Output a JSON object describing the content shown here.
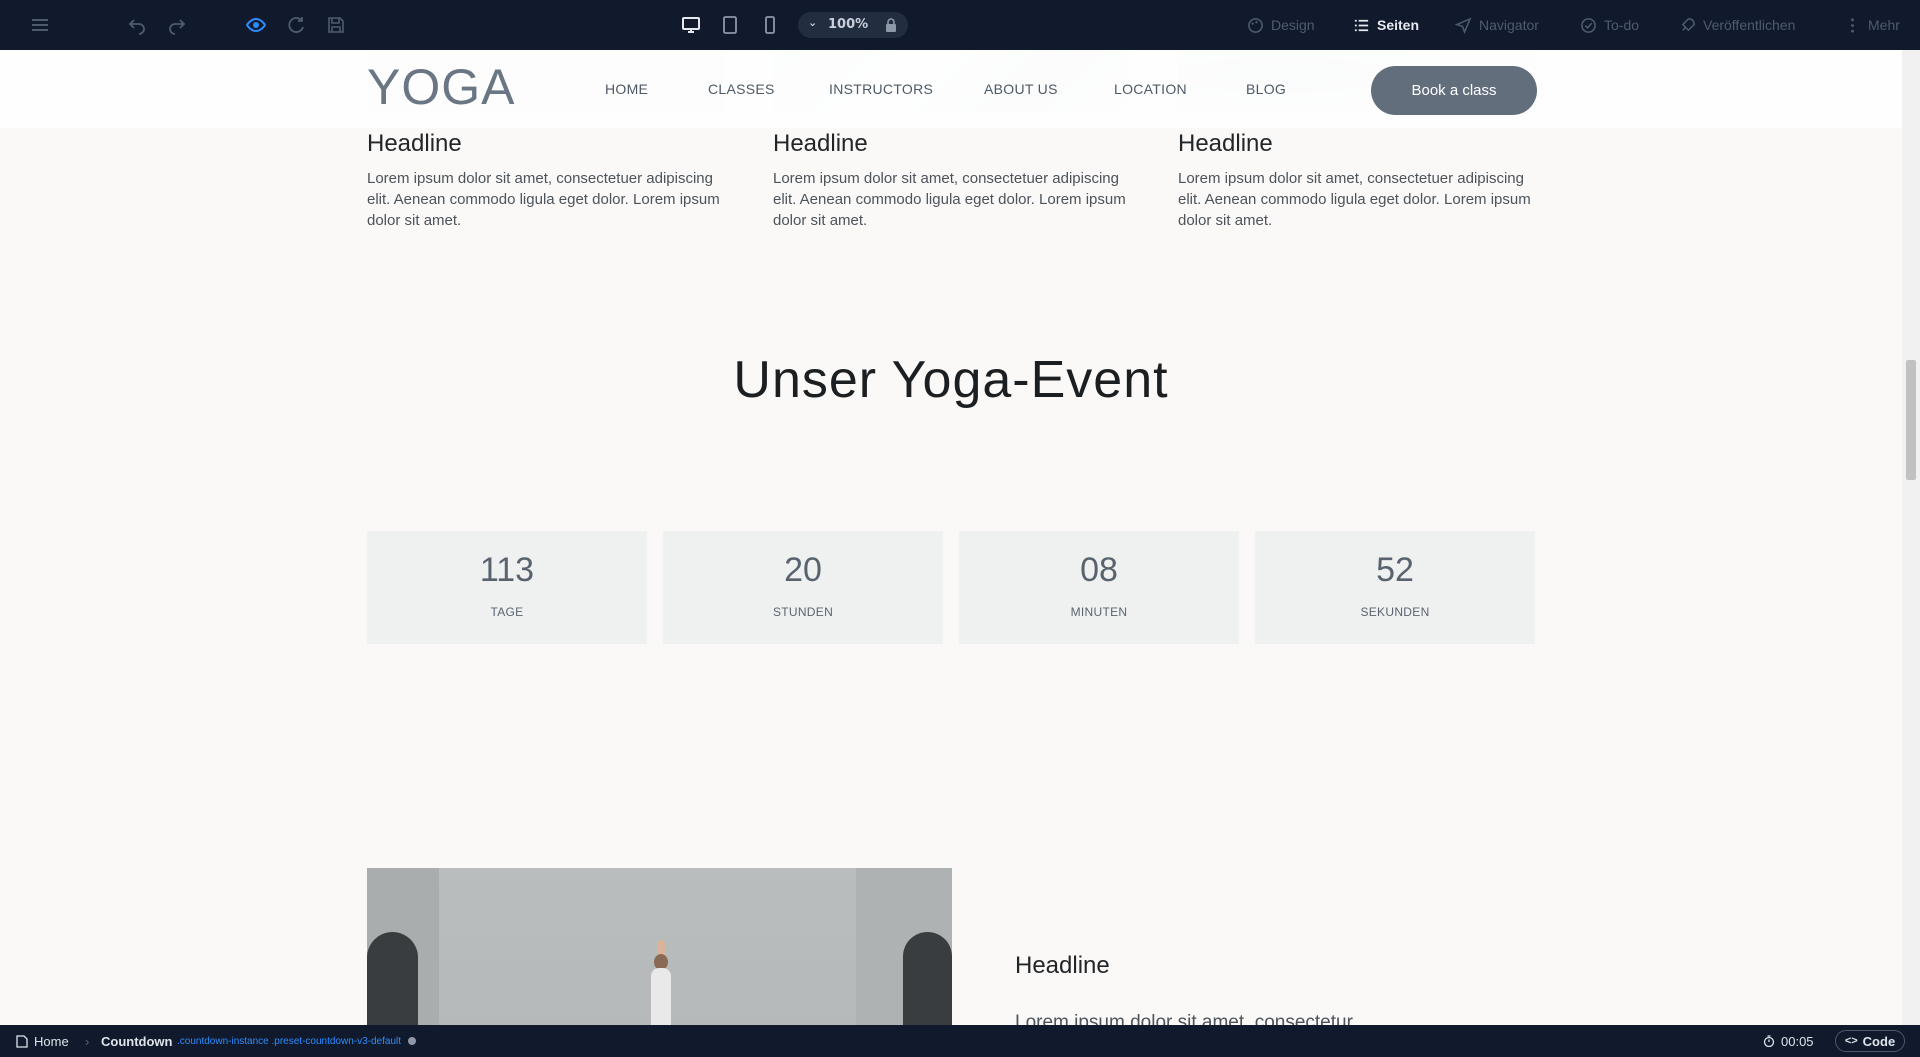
{
  "toolbar": {
    "zoom": "100%",
    "design_label": "Design",
    "pages_label": "Seiten",
    "navigator_label": "Navigator",
    "todo_label": "To-do",
    "publish_label": "Veröffentlichen",
    "more_label": "Mehr"
  },
  "site": {
    "logo": "YOGA",
    "nav": [
      "HOME",
      "CLASSES",
      "INSTRUCTORS",
      "ABOUT US",
      "LOCATION",
      "BLOG"
    ],
    "cta": "Book a class"
  },
  "cards": [
    {
      "headline": "Headline",
      "text": "Lorem ipsum dolor sit amet, consectetuer adipiscing elit. Aenean commodo ligula eget dolor. Lorem ipsum dolor sit amet."
    },
    {
      "headline": "Headline",
      "text": "Lorem ipsum dolor sit amet, consectetuer adipiscing elit. Aenean commodo ligula eget dolor. Lorem ipsum dolor sit amet."
    },
    {
      "headline": "Headline",
      "text": "Lorem ipsum dolor sit amet, consectetuer adipiscing elit. Aenean commodo ligula eget dolor. Lorem ipsum dolor sit amet."
    }
  ],
  "event": {
    "title": "Unser Yoga-Event",
    "countdown": [
      {
        "value": "113",
        "label": "TAGE"
      },
      {
        "value": "20",
        "label": "STUNDEN"
      },
      {
        "value": "08",
        "label": "MINUTEN"
      },
      {
        "value": "52",
        "label": "SEKUNDEN"
      }
    ]
  },
  "section2": {
    "headline": "Headline",
    "text": "Lorem ipsum dolor sit amet, consectetur"
  },
  "statusbar": {
    "page": "Home",
    "element": "Countdown",
    "selector": ".countdown-instance .preset-countdown-v3-default",
    "timer": "00:05",
    "code_label": "Code"
  },
  "colors": {
    "toolbar_bg": "#111a2c",
    "accent_blue": "#2d8cff",
    "cta_bg": "#636e7d",
    "countdown_bg": "#eff1f1"
  }
}
